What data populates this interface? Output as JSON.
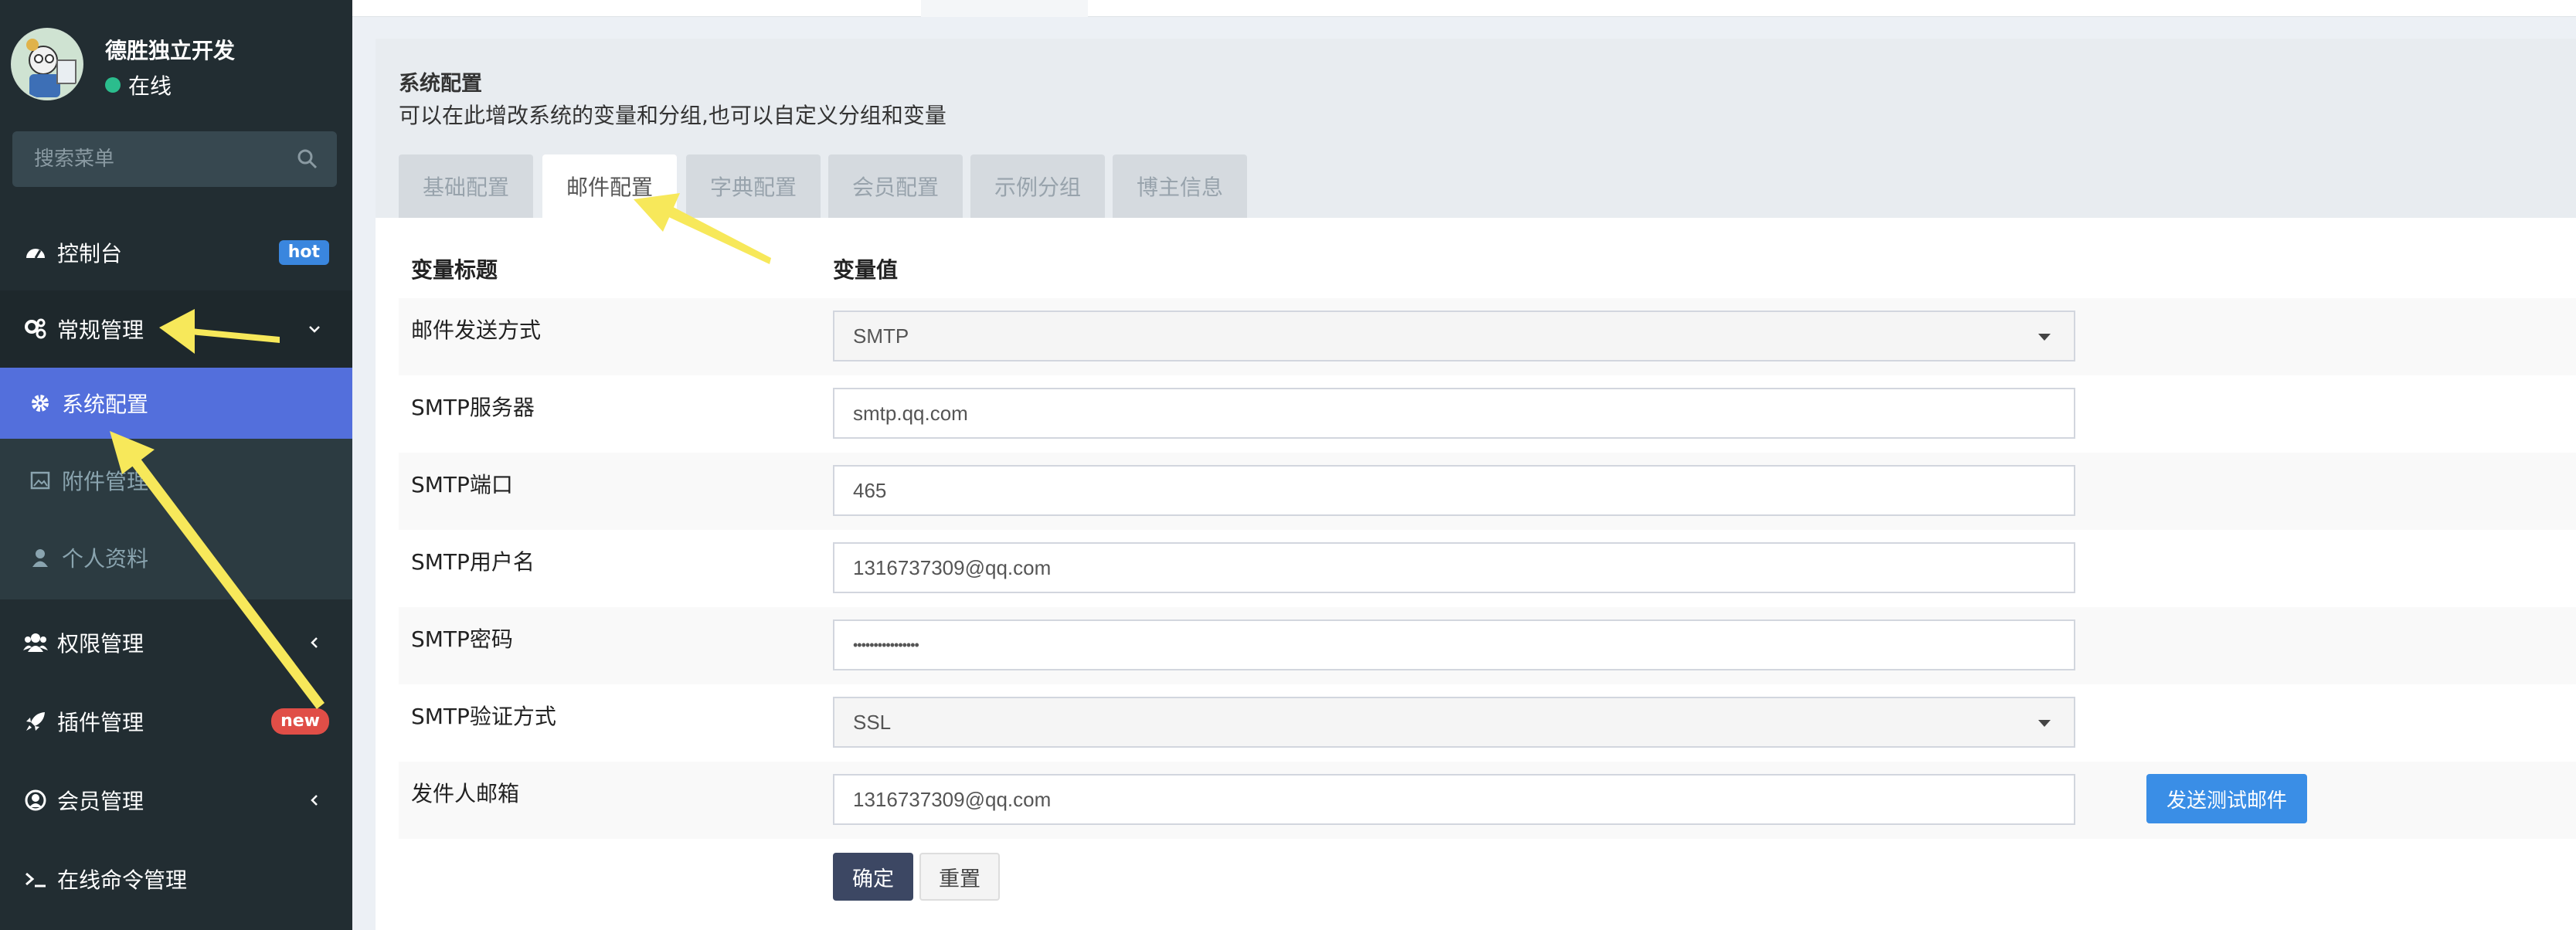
{
  "user": {
    "name": "德胜独立开发",
    "status": "在线"
  },
  "search": {
    "placeholder": "搜索菜单"
  },
  "sidebar": {
    "items": [
      {
        "label": "控制台",
        "icon": "dashboard-icon",
        "badge": "hot"
      },
      {
        "label": "常规管理",
        "icon": "cogs-icon"
      },
      {
        "label": "权限管理",
        "icon": "group-icon"
      },
      {
        "label": "插件管理",
        "icon": "rocket-icon",
        "badge": "new"
      },
      {
        "label": "会员管理",
        "icon": "user-circle-icon"
      },
      {
        "label": "在线命令管理",
        "icon": "terminal-icon"
      }
    ],
    "sub_items": [
      {
        "label": "系统配置",
        "icon": "gear-icon",
        "active": true
      },
      {
        "label": "附件管理",
        "icon": "image-icon"
      },
      {
        "label": "个人资料",
        "icon": "user-icon"
      }
    ]
  },
  "panel": {
    "title": "系统配置",
    "description": "可以在此增改系统的变量和分组,也可以自定义分组和变量",
    "tabs": [
      "基础配置",
      "邮件配置",
      "字典配置",
      "会员配置",
      "示例分组",
      "博主信息"
    ],
    "active_tab": "邮件配置"
  },
  "table": {
    "headers": [
      "变量标题",
      "变量值"
    ],
    "rows": [
      {
        "label": "邮件发送方式",
        "value": "SMTP",
        "type": "select"
      },
      {
        "label": "SMTP服务器",
        "value": "smtp.qq.com",
        "type": "input"
      },
      {
        "label": "SMTP端口",
        "value": "465",
        "type": "input"
      },
      {
        "label": "SMTP用户名",
        "value": "1316737309@qq.com",
        "type": "input"
      },
      {
        "label": "SMTP密码",
        "value": "••••••••••••••••",
        "type": "password"
      },
      {
        "label": "SMTP验证方式",
        "value": "SSL",
        "type": "select"
      },
      {
        "label": "发件人邮箱",
        "value": "1316737309@qq.com",
        "type": "input"
      }
    ]
  },
  "buttons": {
    "send_test": "发送测试邮件",
    "confirm": "确定",
    "reset": "重置"
  },
  "colors": {
    "sidebar_bg": "#222d32",
    "active_item": "#536fdc",
    "primary_btn": "#3a8ee6",
    "annotation_arrow": "#f7e85a"
  }
}
